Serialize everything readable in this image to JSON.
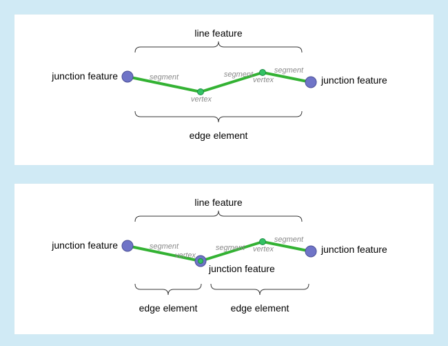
{
  "panel1": {
    "top_label": "line feature",
    "left_junction": "junction feature",
    "right_junction": "junction feature",
    "seg1": "segment",
    "seg2": "segment",
    "seg3": "segment",
    "vtx1": "vertex",
    "vtx2": "vertex",
    "bottom_label": "edge element"
  },
  "panel2": {
    "top_label": "line feature",
    "left_junction": "junction feature",
    "right_junction": "junction feature",
    "mid_junction": "junction feature",
    "seg1": "segment",
    "seg2": "segment",
    "seg3": "segment",
    "vtx1": "vertex",
    "vtx2": "vertex",
    "bottom_left": "edge element",
    "bottom_right": "edge element"
  }
}
